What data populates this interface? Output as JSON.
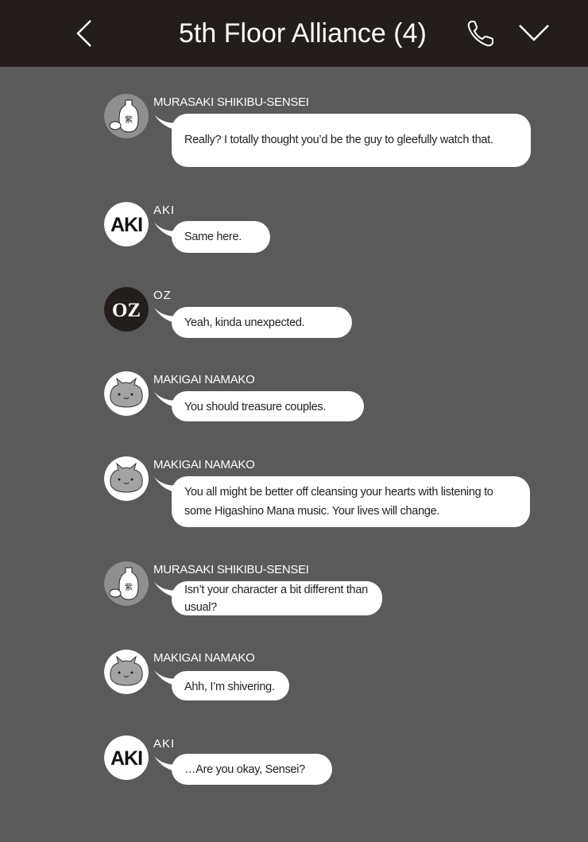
{
  "header": {
    "title": "5th Floor Alliance (4)",
    "background": "#231d1b"
  },
  "chat": {
    "background": "#5b5a5b",
    "avatars": {
      "sake": {
        "label": "紫"
      },
      "aki": {
        "label": "AKI"
      },
      "oz": {
        "label": "OZ"
      },
      "cat": {
        "label": ""
      }
    },
    "messages": [
      {
        "sender": "MURASAKI SHIKIBU-SENSEI",
        "avatar": "sake-icon",
        "text": "Really? I totally thought you’d be the guy to gleefully watch that."
      },
      {
        "sender": "AKI",
        "avatar": "aki-logo",
        "text": "Same here."
      },
      {
        "sender": "OZ",
        "avatar": "oz-logo",
        "text": "Yeah, kinda unexpected."
      },
      {
        "sender": "MAKIGAI NAMAKO",
        "avatar": "cat-face-icon",
        "text": "You should treasure couples."
      },
      {
        "sender": "MAKIGAI NAMAKO",
        "avatar": "cat-face-icon",
        "text": "You all might be better off cleansing your hearts with listening to some Higashino Mana music. Your lives will change."
      },
      {
        "sender": "MURASAKI SHIKIBU-SENSEI",
        "avatar": "sake-icon",
        "text": "Isn’t your character a bit different than usual?"
      },
      {
        "sender": "MAKIGAI NAMAKO",
        "avatar": "cat-face-icon",
        "text": "Ahh, I’m shivering."
      },
      {
        "sender": "AKI",
        "avatar": "aki-logo",
        "text": "…Are you okay, Sensei?"
      }
    ]
  }
}
